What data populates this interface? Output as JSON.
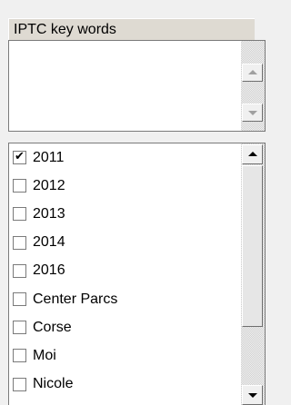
{
  "iptc": {
    "header_label": "IPTC key words",
    "text_value": "",
    "scroll_up_icon": "scroll-up-arrow",
    "scroll_down_icon": "scroll-down-arrow"
  },
  "keywords": {
    "items": [
      {
        "label": "2011",
        "checked": true
      },
      {
        "label": "2012",
        "checked": false
      },
      {
        "label": "2013",
        "checked": false
      },
      {
        "label": "2014",
        "checked": false
      },
      {
        "label": "2016",
        "checked": false
      },
      {
        "label": "Center Parcs",
        "checked": false
      },
      {
        "label": "Corse",
        "checked": false
      },
      {
        "label": "Moi",
        "checked": false
      },
      {
        "label": "Nicole",
        "checked": false
      }
    ],
    "check_glyph": "✔",
    "scroll_up_icon": "scroll-up-arrow",
    "scroll_down_icon": "scroll-down-arrow"
  },
  "colors": {
    "window_bg": "#f0f0f0",
    "header_bg": "#dedad2",
    "field_bg": "#ffffff",
    "border": "#7a7a7a"
  }
}
